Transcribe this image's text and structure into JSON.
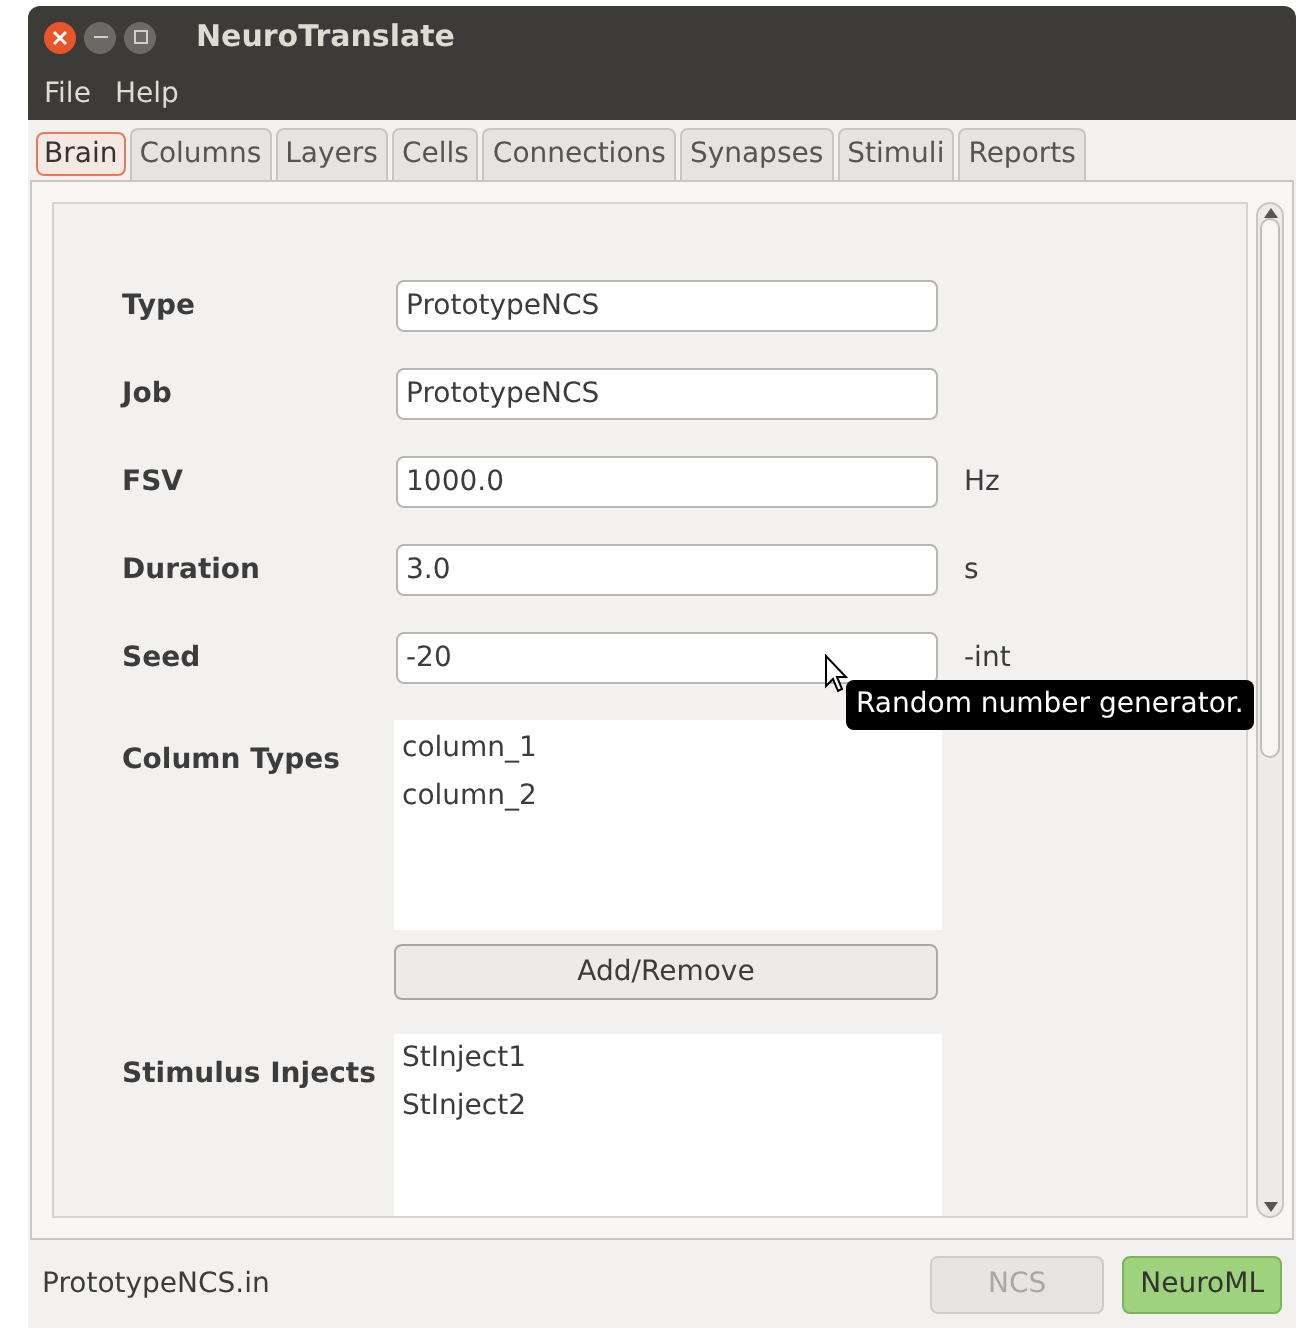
{
  "window": {
    "title": "NeuroTranslate"
  },
  "menu": [
    "File",
    "Help"
  ],
  "tabs": [
    {
      "label": "Brain",
      "selected": true
    },
    {
      "label": "Columns",
      "selected": false
    },
    {
      "label": "Layers",
      "selected": false
    },
    {
      "label": "Cells",
      "selected": false
    },
    {
      "label": "Connections",
      "selected": false
    },
    {
      "label": "Synapses",
      "selected": false
    },
    {
      "label": "Stimuli",
      "selected": false
    },
    {
      "label": "Reports",
      "selected": false
    }
  ],
  "fields": [
    {
      "label": "Type",
      "value": "PrototypeNCS"
    },
    {
      "label": "Job",
      "value": "PrototypeNCS"
    },
    {
      "label": "FSV",
      "value": "1000.0",
      "unit": "Hz"
    },
    {
      "label": "Duration",
      "value": "3.0",
      "unit": "s"
    },
    {
      "label": "Seed",
      "value": "-20",
      "unit": "-int"
    }
  ],
  "column_types": {
    "label": "Column Types",
    "items": [
      "column_1",
      "column_2"
    ],
    "button": "Add/Remove"
  },
  "stimulus_injects": {
    "label": "Stimulus Injects",
    "items": [
      "StInject1",
      "StInject2"
    ]
  },
  "tooltip": "Random number generator.",
  "status_bar": {
    "file": "PrototypeNCS.in",
    "buttons": [
      {
        "label": "NCS",
        "disabled": true
      },
      {
        "label": "NeuroML",
        "disabled": false
      }
    ]
  }
}
